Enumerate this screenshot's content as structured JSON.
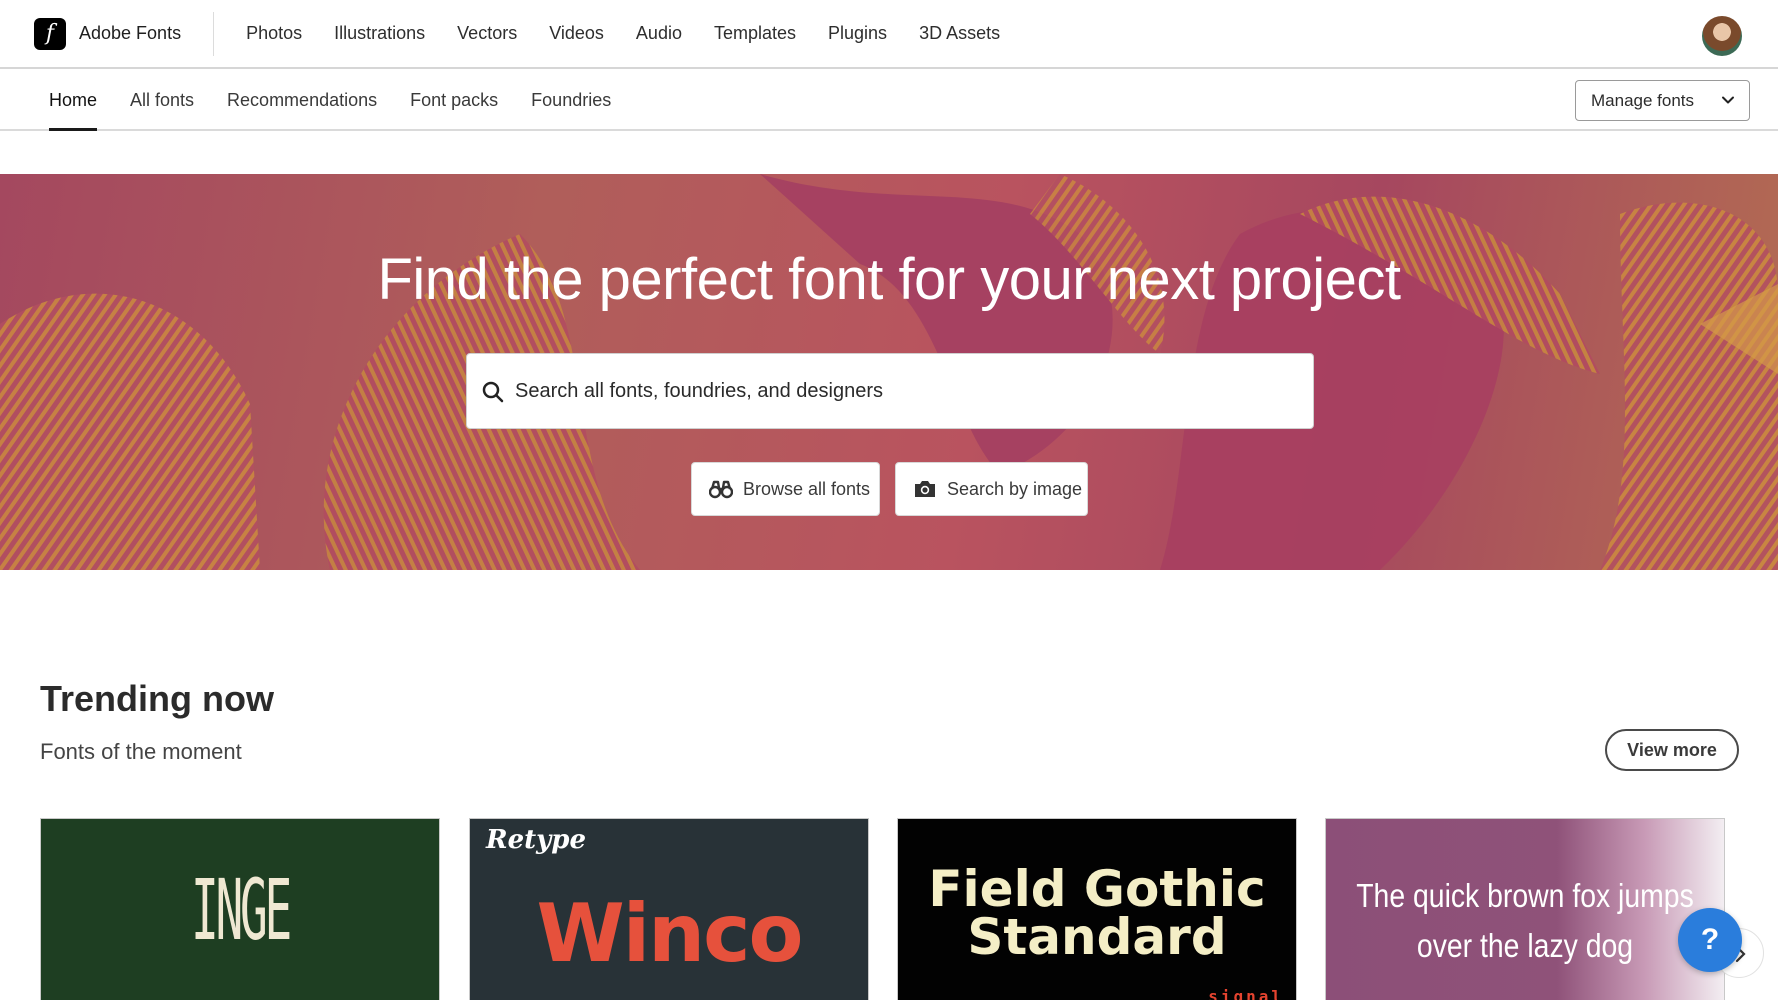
{
  "brand": {
    "name": "Adobe Fonts",
    "logo_letter": "f"
  },
  "global_nav": [
    "Photos",
    "Illustrations",
    "Vectors",
    "Videos",
    "Audio",
    "Templates",
    "Plugins",
    "3D Assets"
  ],
  "sub_nav": {
    "items": [
      "Home",
      "All fonts",
      "Recommendations",
      "Font packs",
      "Foundries"
    ],
    "active": "Home",
    "manage_label": "Manage fonts"
  },
  "hero": {
    "title": "Find the perfect font for your next project",
    "search_placeholder": "Search all fonts, foundries, and designers",
    "browse_label": "Browse all fonts",
    "image_search_label": "Search by image"
  },
  "trending": {
    "title": "Trending now",
    "subtitle": "Fonts of the moment",
    "view_more": "View more",
    "cards": [
      {
        "sample": "INGE"
      },
      {
        "foundry": "Retype",
        "sample": "Winco"
      },
      {
        "sample_line1": "Field Gothic",
        "sample_line2": "Standard",
        "tag": "signal"
      },
      {
        "sample_line1": "The quick brown fox jumps",
        "sample_line2": "over the lazy dog"
      }
    ]
  },
  "help_label": "?",
  "icons": {
    "search": "search-icon",
    "binoculars": "binoculars-icon",
    "camera": "camera-icon",
    "chevron": "chevron-down-icon",
    "next": "chevron-right-icon"
  },
  "colors": {
    "hero_base": "#a9485f",
    "hero_gold": "#c98c3c",
    "help_blue": "#2a7ddc",
    "card_inge": "#1e3e22",
    "card_winco": "#283237",
    "winco_red": "#e6513c"
  }
}
